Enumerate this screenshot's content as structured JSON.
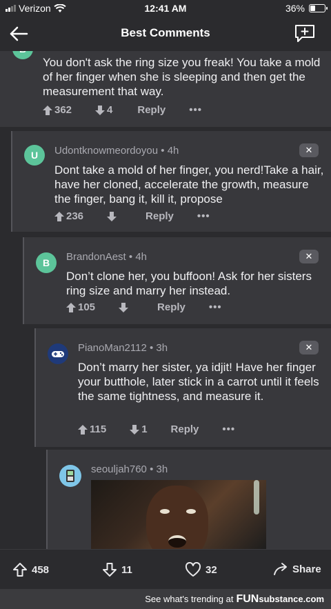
{
  "status": {
    "carrier": "Verizon",
    "time": "12:41 AM",
    "battery": "36%",
    "battery_level": 0.36
  },
  "header": {
    "title": "Best Comments"
  },
  "comments": [
    {
      "text": "You don't ask the ring size you freak! You take a mold of her finger when she is sleeping and then get the measurement that way.",
      "upvotes": "362",
      "downvotes": "4",
      "reply": "Reply",
      "more": "•••"
    },
    {
      "avatar": "U",
      "author": "Udontknowmeordoyou",
      "sep": "•",
      "time": "4h",
      "close": "✕",
      "text": "Dont take a mold of her finger, you nerd!Take a hair, have her cloned, accelerate the growth, measure the finger, bang it, kill it, propose",
      "upvotes": "236",
      "downvotes": "",
      "reply": "Reply",
      "more": "•••"
    },
    {
      "avatar": "B",
      "author": "BrandonAest",
      "sep": "•",
      "time": "4h",
      "close": "✕",
      "text": "Don’t clone her, you buffoon! Ask for her sisters ring size and marry her instead.",
      "upvotes": "105",
      "downvotes": "",
      "reply": "Reply",
      "more": "•••"
    },
    {
      "author": "PianoMan2112",
      "sep": "•",
      "time": "3h",
      "close": "✕",
      "text": "Don’t marry her sister, ya idjit! Have her finger your butthole, later stick in a carrot until it feels the same tightness, and measure it.",
      "upvotes": "115",
      "downvotes": "1",
      "reply": "Reply",
      "more": "•••"
    },
    {
      "author": "seouljah760",
      "sep": "•",
      "time": "3h"
    }
  ],
  "bottom": {
    "upvotes": "458",
    "downvotes": "11",
    "likes": "32",
    "share": "Share"
  },
  "footer": {
    "prefix": "See what's trending at",
    "brand_a": "FUN",
    "brand_b": "substance",
    "brand_c": ".com"
  },
  "colors": {
    "background": "#2b2b2e",
    "card": "#38383c",
    "avatar_green": "#5cc49a",
    "accent_blue": "#3a6fc4"
  }
}
